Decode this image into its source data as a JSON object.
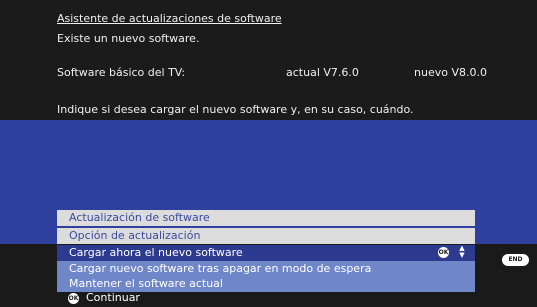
{
  "header": {
    "title": "Asistente de actualizaciones de software",
    "subtitle": "Existe un nuevo software."
  },
  "software_info": {
    "label": "Software básico del TV:",
    "current": "actual V7.6.0",
    "new": "nuevo V8.0.0"
  },
  "question": "Indique si desea cargar el nuevo software y, en su caso, cuándo.",
  "menu": {
    "header1": "Actualización de software",
    "header2": "Opción de actualización",
    "options": [
      "Cargar ahora el nuevo software",
      "Cargar nuevo software tras apagar en modo de espera",
      "Mantener el software actual"
    ],
    "selected_index": 0
  },
  "badges": {
    "ok": "OK",
    "end": "END"
  },
  "footer": {
    "continue_label": "Continuar"
  },
  "colors": {
    "blue_band": "#2f3f9e",
    "menu_item": "#6f86c8",
    "menu_selected": "#2c3a8f",
    "menu_header": "#dcdcdc"
  },
  "icons": [
    "ok-button-icon",
    "up-down-arrows-icon",
    "end-button-icon"
  ]
}
